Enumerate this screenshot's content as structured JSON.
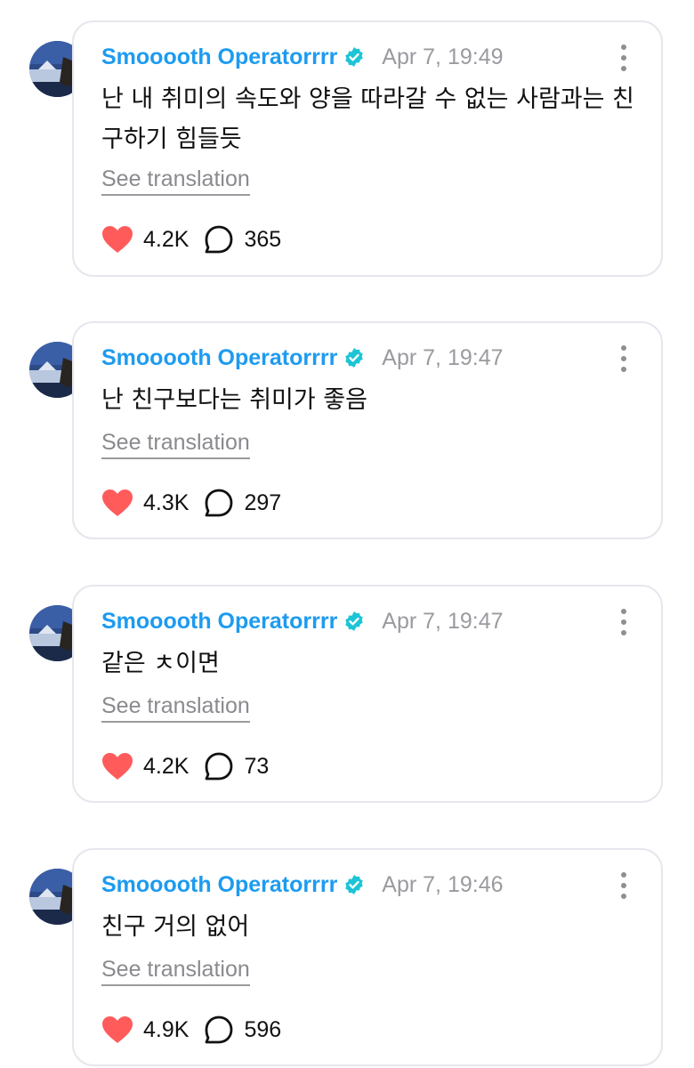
{
  "colors": {
    "accent": "#1d9bf0",
    "verified": "#1dc4d6",
    "heart": "#ff5b5b",
    "muted": "#9a9aa0"
  },
  "posts": [
    {
      "author": "Smooooth Operatorrrr",
      "time": "Apr 7, 19:49",
      "text": "난 내 취미의 속도와 양을 따라갈 수 없는 사람과는 친구하기 힘들듯",
      "translate_label": "See translation",
      "likes": "4.2K",
      "replies": "365"
    },
    {
      "author": "Smooooth Operatorrrr",
      "time": "Apr 7, 19:47",
      "text": "난 친구보다는 취미가 좋음",
      "translate_label": "See translation",
      "likes": "4.3K",
      "replies": "297"
    },
    {
      "author": "Smooooth Operatorrrr",
      "time": "Apr 7, 19:47",
      "text": "같은 ㅊ이면",
      "translate_label": "See translation",
      "likes": "4.2K",
      "replies": "73"
    },
    {
      "author": "Smooooth Operatorrrr",
      "time": "Apr 7, 19:46",
      "text": "친구 거의 없어",
      "translate_label": "See translation",
      "likes": "4.9K",
      "replies": "596"
    }
  ]
}
